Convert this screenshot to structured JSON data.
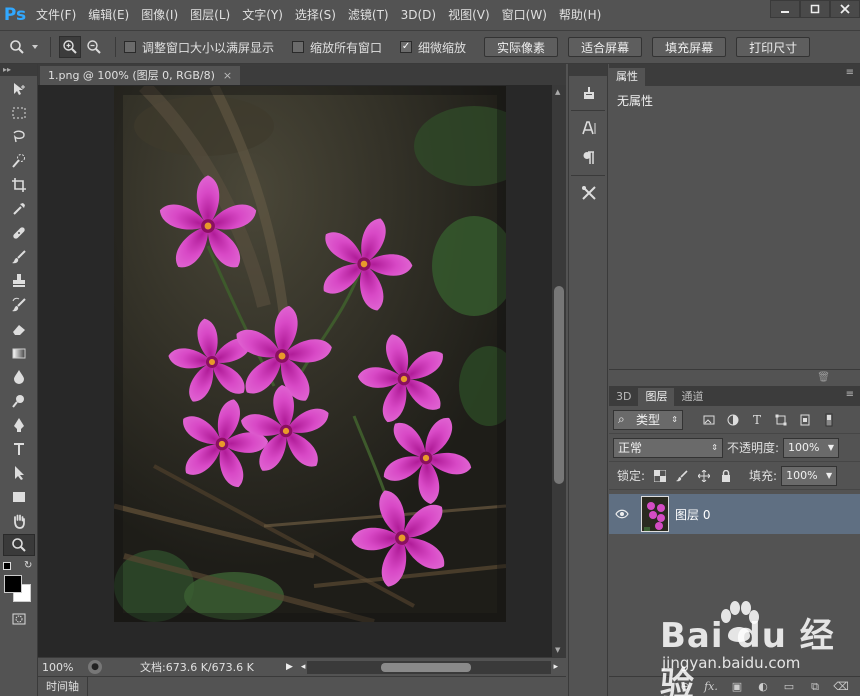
{
  "app": {
    "logo": "Ps",
    "menu": [
      "文件(F)",
      "编辑(E)",
      "图像(I)",
      "图层(L)",
      "文字(Y)",
      "选择(S)",
      "滤镜(T)",
      "3D(D)",
      "视图(V)",
      "窗口(W)",
      "帮助(H)"
    ],
    "window_controls": [
      "minimize-icon",
      "maximize-icon",
      "close-icon"
    ]
  },
  "options_bar": {
    "tool_icon": "zoom-icon",
    "zoom_in_icon": "zoom-in-icon",
    "zoom_out_icon": "zoom-out-icon",
    "checkboxes": [
      {
        "label": "调整窗口大小以满屏显示",
        "checked": false
      },
      {
        "label": "缩放所有窗口",
        "checked": false
      },
      {
        "label": "细微缩放",
        "checked": true
      }
    ],
    "buttons": [
      "实际像素",
      "适合屏幕",
      "填充屏幕",
      "打印尺寸"
    ]
  },
  "tools": [
    {
      "name": "move-tool",
      "icon": "move-icon"
    },
    {
      "name": "marquee-tool",
      "icon": "marquee-icon"
    },
    {
      "name": "lasso-tool",
      "icon": "lasso-icon"
    },
    {
      "name": "quick-select-tool",
      "icon": "quick-select-icon"
    },
    {
      "name": "crop-tool",
      "icon": "crop-icon"
    },
    {
      "name": "eyedropper-tool",
      "icon": "eyedropper-icon"
    },
    {
      "name": "healing-brush-tool",
      "icon": "bandage-icon"
    },
    {
      "name": "brush-tool",
      "icon": "brush-icon"
    },
    {
      "name": "clone-stamp-tool",
      "icon": "stamp-icon"
    },
    {
      "name": "history-brush-tool",
      "icon": "history-brush-icon"
    },
    {
      "name": "eraser-tool",
      "icon": "eraser-icon"
    },
    {
      "name": "gradient-tool",
      "icon": "gradient-icon"
    },
    {
      "name": "blur-tool",
      "icon": "blur-icon"
    },
    {
      "name": "dodge-tool",
      "icon": "dodge-icon"
    },
    {
      "name": "pen-tool",
      "icon": "pen-icon"
    },
    {
      "name": "type-tool",
      "icon": "type-icon"
    },
    {
      "name": "path-select-tool",
      "icon": "arrow-icon"
    },
    {
      "name": "shape-tool",
      "icon": "rectangle-icon"
    },
    {
      "name": "hand-tool",
      "icon": "hand-icon"
    },
    {
      "name": "zoom-tool",
      "icon": "zoom-icon",
      "active": true
    }
  ],
  "colors": {
    "foreground": "#000000",
    "background": "#ffffff",
    "layer_selected": "#5f6f82",
    "accent": "#31a8ff"
  },
  "document": {
    "tab_label": "1.png @ 100% (图层 0, RGB/8)",
    "tab_close": "×",
    "zoom": "100%",
    "info": "文档:673.6 K/673.6 K"
  },
  "timeline": {
    "label": "时间轴"
  },
  "properties_panel": {
    "tab": "属性",
    "body": "无属性"
  },
  "layers_panel": {
    "tabs": [
      "3D",
      "图层",
      "通道"
    ],
    "active_tab": "图层",
    "filter_label": "类型",
    "blend_mode": "正常",
    "opacity_label": "不透明度:",
    "opacity_value": "100%",
    "lock_label": "锁定:",
    "fill_label": "填充:",
    "fill_value": "100%",
    "layers": [
      {
        "name": "图层 0",
        "visible": true
      }
    ]
  },
  "watermark": {
    "text": "Bai du 经验",
    "url": "jingyan.baidu.com"
  }
}
